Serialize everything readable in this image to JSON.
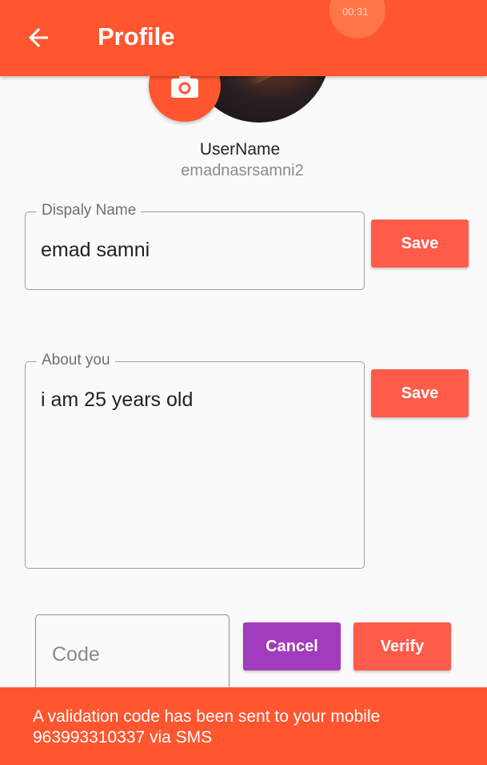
{
  "app_bar": {
    "title": "Profile",
    "timer": "00:31",
    "background_color": "#ff5630"
  },
  "icons": {
    "back": "arrow-back-icon",
    "camera": "camera-icon"
  },
  "profile": {
    "username_label": "UserName",
    "handle": "emadnasrsamni2"
  },
  "display_name": {
    "label": "Dispaly Name",
    "value": "emad samni",
    "save_label": "Save"
  },
  "about": {
    "label": "About you",
    "value": "i am 25 years old",
    "save_label": "Save"
  },
  "verification": {
    "code_placeholder": "Code",
    "cancel_label": "Cancel",
    "verify_label": "Verify",
    "cancel_color": "#a23bbd",
    "verify_color": "#ff5b4a"
  },
  "snackbar": {
    "message": "A validation code has been sent to your mobile 963993310337 via SMS"
  }
}
